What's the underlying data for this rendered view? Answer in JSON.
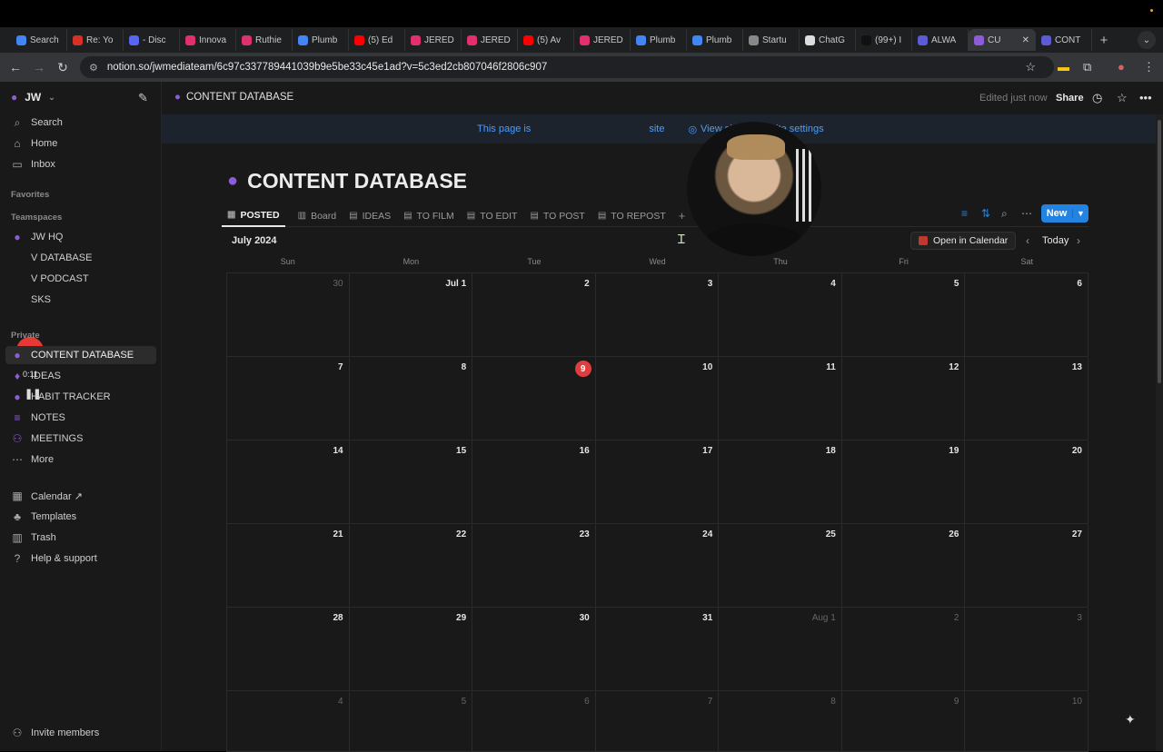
{
  "browser": {
    "tabs": [
      {
        "label": "Search",
        "color": "#4285f4"
      },
      {
        "label": "Re: Yo",
        "color": "#d93025"
      },
      {
        "label": "- Disc",
        "color": "#5865f2"
      },
      {
        "label": "Innova",
        "color": "#e1306c"
      },
      {
        "label": "Ruthie",
        "color": "#e1306c"
      },
      {
        "label": "Plumb",
        "color": "#4285f4"
      },
      {
        "label": "(5) Ed",
        "color": "#ff0000"
      },
      {
        "label": "JERED",
        "color": "#e1306c"
      },
      {
        "label": "JERED",
        "color": "#e1306c"
      },
      {
        "label": "(5) Av",
        "color": "#ff0000"
      },
      {
        "label": "JERED",
        "color": "#e1306c"
      },
      {
        "label": "Plumb",
        "color": "#4285f4"
      },
      {
        "label": "Plumb",
        "color": "#4285f4"
      },
      {
        "label": "Startu",
        "color": "#888888"
      },
      {
        "label": "ChatG",
        "color": "#dddddd"
      },
      {
        "label": "(99+) I",
        "color": "#111111"
      },
      {
        "label": "ALWA",
        "color": "#5b5bd6"
      },
      {
        "label": "CU",
        "color": "#8e5cd9",
        "active": true
      },
      {
        "label": "CONT",
        "color": "#5b5bd6"
      }
    ],
    "new_tab": "+",
    "url": "notion.so/jwmediateam/6c97c337789441039b9e5be33c45e1ad?v=5c3ed2cb807046f2806c907"
  },
  "sidebar": {
    "workspace": "JW",
    "top_items": [
      {
        "label": "Search",
        "icon": "search-icon"
      },
      {
        "label": "Home",
        "icon": "home-icon"
      },
      {
        "label": "Inbox",
        "icon": "inbox-icon"
      }
    ],
    "favorites_header": "Favorites",
    "teamspaces_header": "Teamspaces",
    "teamspace_items": [
      {
        "label": "JW HQ"
      },
      {
        "label": "V DATABASE"
      },
      {
        "label": "V PODCAST"
      },
      {
        "label": "SKS"
      }
    ],
    "private_header": "Private",
    "private_items": [
      {
        "label": "CONTENT DATABASE",
        "active": true
      },
      {
        "label": "IDEAS"
      },
      {
        "label": "HABIT TRACKER"
      },
      {
        "label": "NOTES"
      },
      {
        "label": "MEETINGS"
      },
      {
        "label": "More"
      }
    ],
    "bottom_items": [
      {
        "label": "Calendar ↗"
      },
      {
        "label": "Templates"
      },
      {
        "label": "Trash"
      },
      {
        "label": "Help & support"
      }
    ],
    "invite": "Invite members",
    "recording_time": "0:11"
  },
  "header": {
    "breadcrumb": "CONTENT DATABASE",
    "edited": "Edited just now",
    "share": "Share"
  },
  "banner": {
    "text_start": "This page is",
    "text_end": "site",
    "view_site": "View site",
    "site_settings": "Site settings"
  },
  "page": {
    "title": "CONTENT DATABASE",
    "views": [
      {
        "label": "POSTED",
        "active": true
      },
      {
        "label": "Board"
      },
      {
        "label": "IDEAS"
      },
      {
        "label": "TO FILM"
      },
      {
        "label": "TO EDIT"
      },
      {
        "label": "TO POST"
      },
      {
        "label": "TO REPOST"
      }
    ],
    "new_button": "New"
  },
  "calendar": {
    "month": "July 2024",
    "open_in_calendar": "Open in Calendar",
    "today": "Today",
    "weekdays": [
      "Sun",
      "Mon",
      "Tue",
      "Wed",
      "Thu",
      "Fri",
      "Sat"
    ],
    "days": [
      {
        "d": "30",
        "out": true
      },
      {
        "d": "Jul 1"
      },
      {
        "d": "2"
      },
      {
        "d": "3"
      },
      {
        "d": "4"
      },
      {
        "d": "5"
      },
      {
        "d": "6"
      },
      {
        "d": "7"
      },
      {
        "d": "8"
      },
      {
        "d": "9",
        "today": true
      },
      {
        "d": "10"
      },
      {
        "d": "11"
      },
      {
        "d": "12"
      },
      {
        "d": "13"
      },
      {
        "d": "14"
      },
      {
        "d": "15"
      },
      {
        "d": "16"
      },
      {
        "d": "17"
      },
      {
        "d": "18"
      },
      {
        "d": "19"
      },
      {
        "d": "20"
      },
      {
        "d": "21"
      },
      {
        "d": "22"
      },
      {
        "d": "23"
      },
      {
        "d": "24"
      },
      {
        "d": "25"
      },
      {
        "d": "26"
      },
      {
        "d": "27"
      },
      {
        "d": "28"
      },
      {
        "d": "29"
      },
      {
        "d": "30"
      },
      {
        "d": "31"
      },
      {
        "d": "Aug 1",
        "out": true
      },
      {
        "d": "2",
        "out": true
      },
      {
        "d": "3",
        "out": true
      },
      {
        "d": "4",
        "out": true
      },
      {
        "d": "5",
        "out": true
      },
      {
        "d": "6",
        "out": true
      },
      {
        "d": "7",
        "out": true
      },
      {
        "d": "8",
        "out": true
      },
      {
        "d": "9",
        "out": true
      },
      {
        "d": "10",
        "out": true
      }
    ]
  },
  "colors": {
    "accent": "#2383e2",
    "today": "#e03e3e",
    "purple": "#8e5cd9"
  }
}
